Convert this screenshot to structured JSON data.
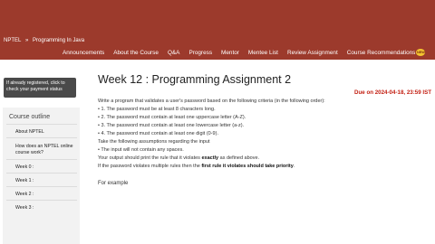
{
  "breadcrumb": {
    "org": "NPTEL",
    "sep": "»",
    "course": "Programming In Java"
  },
  "nav": {
    "items": [
      "Announcements",
      "About the Course",
      "Q&A",
      "Progress",
      "Mentor",
      "Mentee List",
      "Review Assignment",
      "Course Recommendations"
    ],
    "badge": "NEW"
  },
  "sidebar": {
    "payment_notice": "If already registered, click to check your payment status",
    "outline_title": "Course outline",
    "items": [
      "About NPTEL",
      "How does an NPTEL online course work?",
      "Week 0 :",
      "Week 1 :",
      "Week 2 :",
      "Week 3 :"
    ]
  },
  "assignment": {
    "title": "Week 12 : Programming Assignment 2",
    "due": "Due on 2024-04-18, 23:59 IST",
    "intro": "Write a program that validates a user's password based on the following criteria (in the following order):",
    "rules": [
      "• 1. The password must be at least 8 characters long.",
      "• 2. The password must contain at least one uppercase letter (A-Z).",
      "• 3. The password must contain at least one lowercase letter (a-z).",
      "• 4. The password must contain at least one digit (0-9)."
    ],
    "assumptions_intro": "Take the following assumptions regarding the input",
    "assumption": "• The input will not contain any spaces.",
    "output_pre": "Your output should print the rule that it violates ",
    "output_bold": "exactly",
    "output_post": " as defined above.",
    "multi_pre": "If the password violates multiple rules then the ",
    "multi_bold": "first rule it violates should take priority",
    "multi_post": ".",
    "example_label": "For example"
  }
}
